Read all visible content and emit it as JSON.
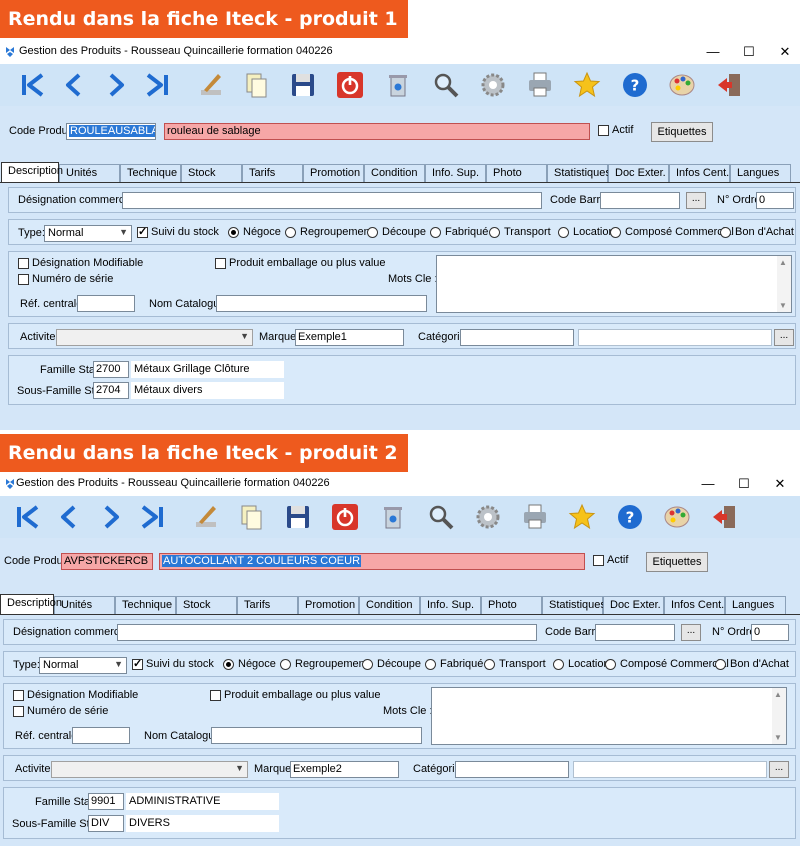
{
  "banners": {
    "first": "Rendu dans la fiche Iteck - produit 1",
    "second": "Rendu dans la fiche Iteck - produit 2"
  },
  "window": {
    "title": "Gestion des Produits - Rousseau Quincaillerie formation 040226",
    "minimize": "—",
    "maximize": "☐",
    "close": "✕"
  },
  "toolbar_icons": [
    "first-record-icon",
    "previous-record-icon",
    "next-record-icon",
    "last-record-icon",
    "edit-icon",
    "copy-icon",
    "save-icon",
    "power-icon",
    "recycle-bin-icon",
    "search-icon",
    "settings-icon",
    "print-icon",
    "favorite-icon",
    "help-icon",
    "palette-icon",
    "exit-icon"
  ],
  "labels": {
    "code_produit": "Code Produit:",
    "actif": "Actif",
    "etiquettes": "Etiquettes",
    "designation_commerciale": "Désignation commerciale:",
    "code_barre": "Code Barre:",
    "browse": "...",
    "n_ordre": "N° Ordre:",
    "type": "Type:",
    "suivi_du_stock": "Suivi du stock",
    "designation_modifiable": "Désignation Modifiable",
    "numero_de_serie": "Numéro de série",
    "produit_emballage": "Produit emballage ou plus value",
    "mots_cle": "Mots Cle :",
    "ref_centrale": "Réf. centrale:",
    "nom_catalogue": "Nom Catalogue:",
    "activite": "Activite:",
    "marque": "Marque:",
    "categorie": "Catégorie:",
    "famille_stat": "Famille Stat.:",
    "sous_famille_stat": "Sous-Famille Stat.:"
  },
  "tabs": [
    "Description",
    "Unités",
    "Technique",
    "Stock",
    "Tarifs",
    "Promotion",
    "Condition",
    "Info. Sup.",
    "Photo",
    "Statistiques",
    "Doc Exter.",
    "Infos Cent.",
    "Langues"
  ],
  "radio_options": [
    "Négoce",
    "Regroupement",
    "Découpe",
    "Fabriqué",
    "Transport",
    "Location",
    "Composé Commercial",
    "Bon d'Achat"
  ],
  "products": [
    {
      "code": "ROULEAUSABLAGE",
      "name": "rouleau de sablage",
      "type": "Normal",
      "n_ordre": "0",
      "marque": "Exemple1",
      "famille_code": "2700",
      "famille_label": "Métaux Grillage Clôture",
      "sous_famille_code": "2704",
      "sous_famille_label": "Métaux divers"
    },
    {
      "code": "AVPSTICKERCB",
      "name": "AUTOCOLLANT  2 COULEURS COEUR",
      "type": "Normal",
      "n_ordre": "0",
      "marque": "Exemple2",
      "famille_code": "9901",
      "famille_label": "ADMINISTRATIVE",
      "sous_famille_code": "DIV",
      "sous_famille_label": "DIVERS"
    }
  ],
  "colors": {
    "banner": "#ee5a1e",
    "toolbar": "#cfe4f7",
    "form_bg": "#d4e6f8",
    "required_field": "#f6a7a7",
    "selection": "#2a78d6"
  }
}
